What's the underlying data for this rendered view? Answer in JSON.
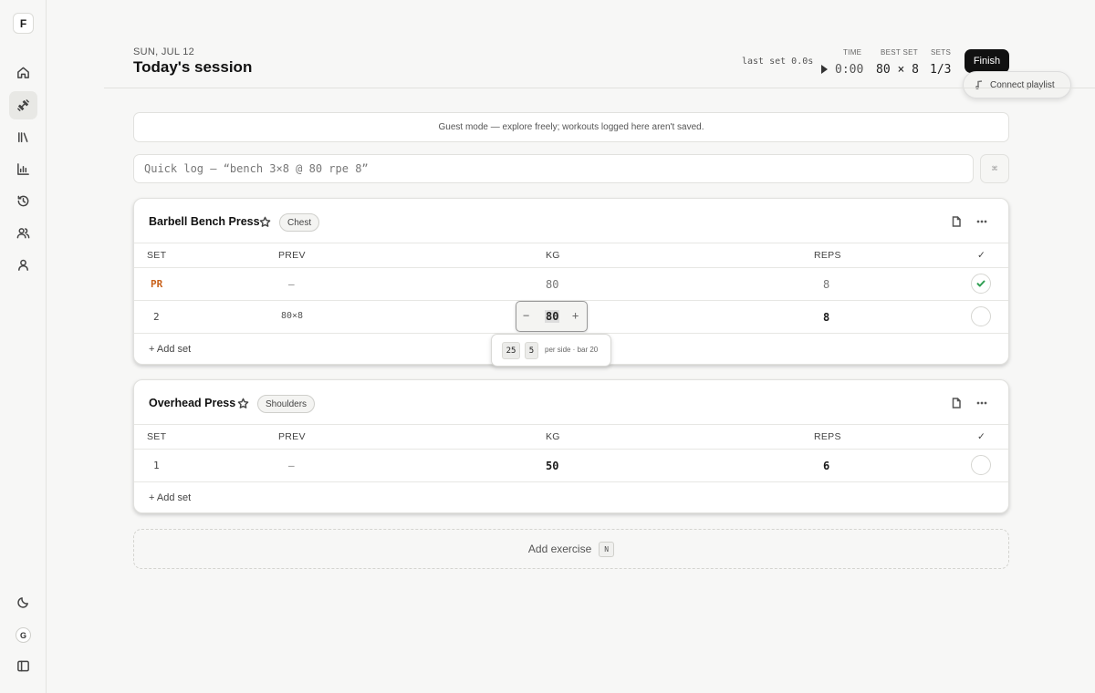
{
  "sidebar": {
    "logo": "F",
    "items": [
      {
        "name": "home-icon"
      },
      {
        "name": "dumbbell-icon",
        "active": true
      },
      {
        "name": "library-icon"
      },
      {
        "name": "bar-chart-icon"
      },
      {
        "name": "history-icon"
      },
      {
        "name": "users-icon"
      },
      {
        "name": "user-icon"
      }
    ],
    "bottom": {
      "theme": "moon-icon",
      "avatar": "G",
      "collapse": "sidebar-toggle-icon"
    }
  },
  "header": {
    "date": "SUN, JUL 12",
    "title": "Today's session",
    "last_set": "last set 0.0s",
    "time_label": "TIME",
    "time_value": "0:00",
    "best_set_label": "BEST SET",
    "best_set_value": "80 × 8",
    "sets_label": "SETS",
    "sets_value": "1/3",
    "finish_label": "Finish",
    "playlist_label": "Connect playlist"
  },
  "banner": "Guest mode — explore freely; workouts logged here aren't saved.",
  "quick_log": {
    "placeholder": "Quick log — “bench 3×8 @ 80 rpe 8”",
    "shortcut": "⌘"
  },
  "columns": {
    "set": "SET",
    "prev": "PREV",
    "kg": "KG",
    "reps": "REPS",
    "done": "✓"
  },
  "exercises": [
    {
      "name": "Barbell Bench Press",
      "tag": "Chest",
      "rows": [
        {
          "set": "PR",
          "prev": "–",
          "kg": "80",
          "reps": "8",
          "done": true
        },
        {
          "set": "2",
          "prev": "80×8",
          "kg": "80",
          "reps": "8",
          "done": false
        }
      ],
      "add_set": "+ Add set"
    },
    {
      "name": "Overhead Press",
      "tag": "Shoulders",
      "rows": [
        {
          "set": "1",
          "prev": "–",
          "kg": "50",
          "reps": "6",
          "done": false
        }
      ],
      "add_set": "+ Add set"
    }
  ],
  "stepper": {
    "minus": "−",
    "value": "80",
    "plus": "+"
  },
  "plates": {
    "chips": [
      "25",
      "5"
    ],
    "note": "per side · bar 20"
  },
  "add_exercise": {
    "label": "Add exercise",
    "shortcut": "N"
  },
  "colors": {
    "pr": "#c8611a",
    "check": "#2f9e52",
    "finish_bg": "#111111"
  }
}
